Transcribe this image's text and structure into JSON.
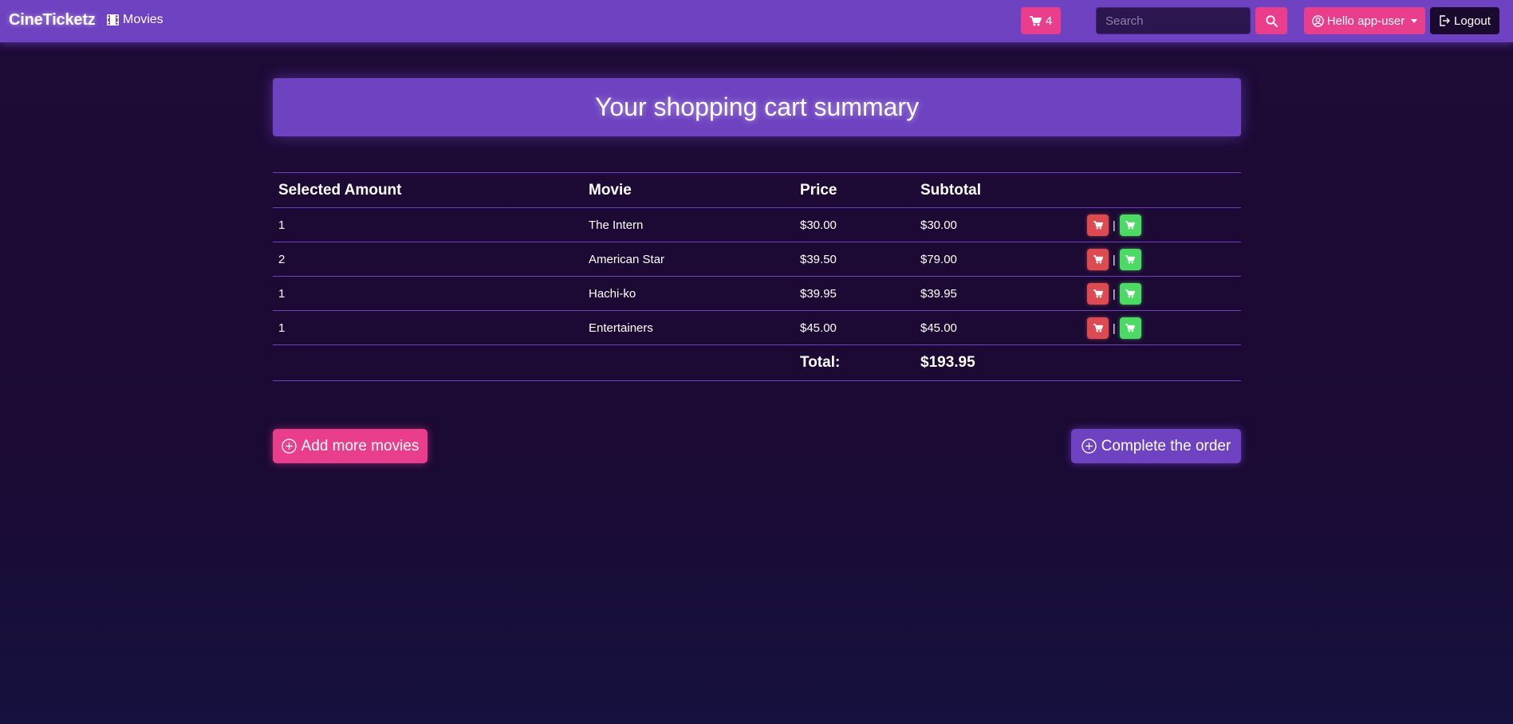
{
  "nav": {
    "brand": "CineTicketz",
    "movies_label": "Movies",
    "cart_count": "4",
    "search_placeholder": "Search",
    "user_label": "Hello app-user",
    "logout_label": "Logout"
  },
  "page": {
    "title": "Your shopping cart summary"
  },
  "table": {
    "headers": [
      "Selected Amount",
      "Movie",
      "Price",
      "Subtotal"
    ],
    "rows": [
      {
        "amount": "1",
        "movie": "The Intern",
        "price": "$30.00",
        "subtotal": "$30.00"
      },
      {
        "amount": "2",
        "movie": "American Star",
        "price": "$39.50",
        "subtotal": "$79.00"
      },
      {
        "amount": "1",
        "movie": "Hachi-ko",
        "price": "$39.95",
        "subtotal": "$39.95"
      },
      {
        "amount": "1",
        "movie": "Entertainers",
        "price": "$45.00",
        "subtotal": "$45.00"
      }
    ],
    "action_separator": "|",
    "total_label": "Total:",
    "total_value": "$193.95"
  },
  "buttons": {
    "add_more": "Add more movies",
    "complete": "Complete the order"
  },
  "colors": {
    "navbar": "#6f42c1",
    "accent_pink": "#e83e8c",
    "remove": "#dc4b50",
    "add": "#4cd964",
    "background": "#1e0b36"
  },
  "icons": {
    "movies": "film-icon",
    "cart": "cart-icon",
    "search": "search-icon",
    "user": "user-circle-icon",
    "logout": "logout-icon",
    "add_circle": "plus-circle-icon"
  }
}
